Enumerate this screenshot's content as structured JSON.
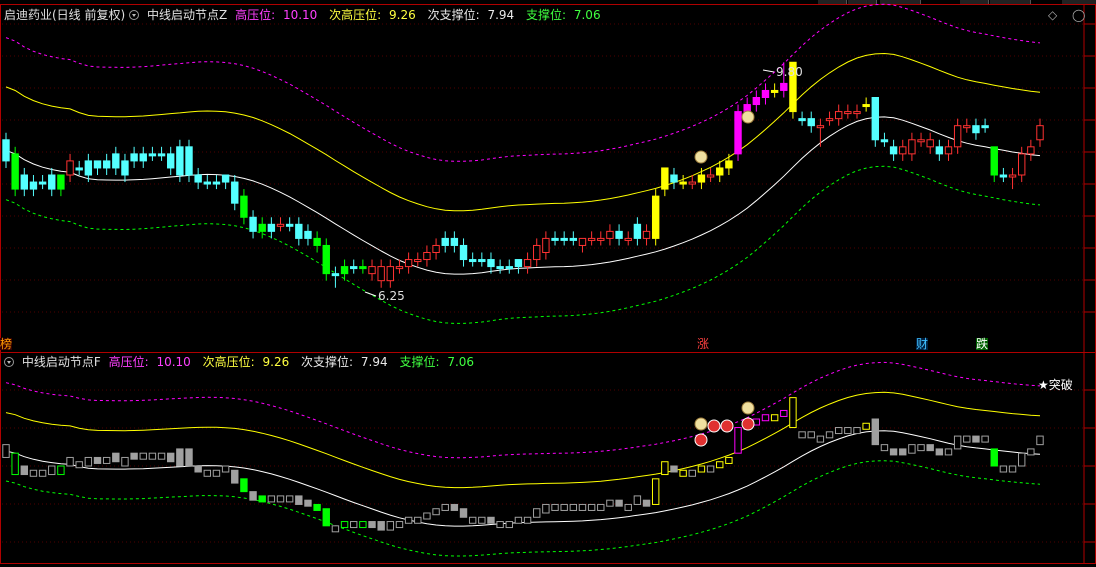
{
  "pane1": {
    "stock": "启迪药业(日线 前复权)",
    "indicator": "中线启动节点Z",
    "high_label": "高压位:",
    "high_val": "10.10",
    "sub_high_label": "次高压位:",
    "sub_high_val": "9.26",
    "sub_sup_label": "次支撑位:",
    "sub_sup_val": "7.94",
    "sup_label": "支撑位:",
    "sup_val": "7.06",
    "high_annot": "9.80",
    "low_annot": "6.25",
    "tags": [
      "榜",
      "涨",
      "财",
      "跌"
    ]
  },
  "pane2": {
    "indicator": "中线启动节点F",
    "high_label": "高压位:",
    "high_val": "10.10",
    "sub_high_label": "次高压位:",
    "sub_high_val": "9.26",
    "sub_sup_label": "次支撑位:",
    "sub_sup_val": "7.94",
    "sup_label": "支撑位:",
    "sup_val": "7.06",
    "breakout": "★突破"
  },
  "colors": {
    "up": "#ff3232",
    "down": "#54ffff",
    "yellow": "#ffff00",
    "magenta": "#ff00ff",
    "green": "#00ff00",
    "white": "#ffffff",
    "grey": "#a0a0a0",
    "frame": "#b00000"
  },
  "chart_data": {
    "type": "candlestick",
    "range": [
      6.25,
      9.8
    ],
    "candles": [
      [
        8.4,
        8.7,
        8.8,
        8.3,
        "c"
      ],
      [
        8.0,
        8.5,
        8.6,
        7.9,
        "g"
      ],
      [
        8.2,
        8.0,
        8.3,
        7.9,
        "c"
      ],
      [
        8.0,
        8.1,
        8.2,
        7.9,
        "c"
      ],
      [
        8.1,
        8.1,
        8.2,
        8.0,
        "c"
      ],
      [
        8.0,
        8.2,
        8.3,
        7.9,
        "c"
      ],
      [
        8.0,
        8.2,
        8.2,
        7.9,
        "g"
      ],
      [
        8.2,
        8.4,
        8.5,
        8.1,
        "r"
      ],
      [
        8.3,
        8.3,
        8.4,
        8.2,
        "c"
      ],
      [
        8.2,
        8.4,
        8.5,
        8.1,
        "c"
      ],
      [
        8.4,
        8.3,
        8.4,
        8.2,
        "c"
      ],
      [
        8.3,
        8.4,
        8.5,
        8.2,
        "c"
      ],
      [
        8.5,
        8.3,
        8.6,
        8.2,
        "c"
      ],
      [
        8.2,
        8.4,
        8.5,
        8.1,
        "c"
      ],
      [
        8.5,
        8.4,
        8.6,
        8.3,
        "c"
      ],
      [
        8.4,
        8.5,
        8.6,
        8.3,
        "c"
      ],
      [
        8.5,
        8.5,
        8.6,
        8.4,
        "c"
      ],
      [
        8.5,
        8.5,
        8.6,
        8.4,
        "c"
      ],
      [
        8.5,
        8.3,
        8.6,
        8.2,
        "c"
      ],
      [
        8.6,
        8.2,
        8.7,
        8.1,
        "c"
      ],
      [
        8.6,
        8.2,
        8.7,
        8.1,
        "c"
      ],
      [
        8.2,
        8.1,
        8.3,
        8.0,
        "c"
      ],
      [
        8.1,
        8.1,
        8.2,
        8.0,
        "c"
      ],
      [
        8.1,
        8.1,
        8.2,
        8.0,
        "c"
      ],
      [
        8.1,
        8.2,
        8.2,
        8.0,
        "c"
      ],
      [
        8.1,
        7.8,
        8.2,
        7.7,
        "c"
      ],
      [
        7.9,
        7.6,
        8.0,
        7.5,
        "g"
      ],
      [
        7.6,
        7.4,
        7.7,
        7.3,
        "c"
      ],
      [
        7.5,
        7.4,
        7.6,
        7.3,
        "g"
      ],
      [
        7.4,
        7.5,
        7.6,
        7.3,
        "c"
      ],
      [
        7.5,
        7.5,
        7.6,
        7.4,
        "r"
      ],
      [
        7.5,
        7.5,
        7.6,
        7.4,
        "c"
      ],
      [
        7.5,
        7.3,
        7.6,
        7.2,
        "c"
      ],
      [
        7.4,
        7.3,
        7.5,
        7.2,
        "c"
      ],
      [
        7.3,
        7.2,
        7.4,
        7.1,
        "g"
      ],
      [
        7.2,
        6.8,
        7.3,
        6.7,
        "g"
      ],
      [
        6.8,
        6.8,
        6.9,
        6.6,
        "c"
      ],
      [
        6.8,
        6.9,
        7.0,
        6.7,
        "g"
      ],
      [
        6.9,
        6.9,
        7.0,
        6.8,
        "c"
      ],
      [
        6.9,
        6.9,
        7.0,
        6.8,
        "g"
      ],
      [
        6.9,
        6.8,
        7.0,
        6.7,
        "r"
      ],
      [
        6.9,
        6.7,
        7.0,
        6.6,
        "r"
      ],
      [
        6.7,
        6.9,
        7.0,
        6.6,
        "r"
      ],
      [
        6.9,
        6.9,
        7.0,
        6.8,
        "r"
      ],
      [
        6.9,
        7.0,
        7.1,
        6.8,
        "r"
      ],
      [
        7.0,
        7.0,
        7.1,
        6.9,
        "r"
      ],
      [
        7.0,
        7.1,
        7.2,
        6.9,
        "r"
      ],
      [
        7.1,
        7.2,
        7.3,
        7.0,
        "r"
      ],
      [
        7.2,
        7.3,
        7.4,
        7.1,
        "c"
      ],
      [
        7.3,
        7.2,
        7.4,
        7.1,
        "c"
      ],
      [
        7.2,
        7.0,
        7.3,
        6.9,
        "c"
      ],
      [
        7.0,
        7.0,
        7.1,
        6.9,
        "c"
      ],
      [
        7.0,
        7.0,
        7.1,
        6.9,
        "c"
      ],
      [
        7.0,
        6.9,
        7.1,
        6.8,
        "c"
      ],
      [
        6.9,
        6.9,
        7.0,
        6.8,
        "c"
      ],
      [
        6.9,
        6.9,
        7.0,
        6.8,
        "c"
      ],
      [
        6.9,
        7.0,
        7.0,
        6.8,
        "c"
      ],
      [
        6.9,
        7.0,
        7.1,
        6.8,
        "r"
      ],
      [
        7.0,
        7.2,
        7.3,
        6.9,
        "r"
      ],
      [
        7.1,
        7.3,
        7.4,
        7.0,
        "r"
      ],
      [
        7.3,
        7.3,
        7.4,
        7.2,
        "c"
      ],
      [
        7.3,
        7.3,
        7.4,
        7.2,
        "c"
      ],
      [
        7.3,
        7.3,
        7.4,
        7.2,
        "c"
      ],
      [
        7.2,
        7.3,
        7.3,
        7.1,
        "r"
      ],
      [
        7.3,
        7.3,
        7.4,
        7.2,
        "r"
      ],
      [
        7.3,
        7.3,
        7.4,
        7.2,
        "r"
      ],
      [
        7.3,
        7.4,
        7.5,
        7.2,
        "r"
      ],
      [
        7.4,
        7.3,
        7.5,
        7.2,
        "c"
      ],
      [
        7.3,
        7.3,
        7.4,
        7.2,
        "r"
      ],
      [
        7.3,
        7.5,
        7.6,
        7.2,
        "c"
      ],
      [
        7.4,
        7.3,
        7.5,
        7.2,
        "r"
      ],
      [
        7.3,
        7.9,
        8.0,
        7.2,
        "y"
      ],
      [
        8.0,
        8.3,
        8.3,
        7.9,
        "y"
      ],
      [
        8.2,
        8.1,
        8.3,
        8.0,
        "c"
      ],
      [
        8.1,
        8.1,
        8.2,
        8.0,
        "y"
      ],
      [
        8.1,
        8.1,
        8.2,
        8.0,
        "r"
      ],
      [
        8.1,
        8.2,
        8.3,
        8.0,
        "y"
      ],
      [
        8.2,
        8.2,
        8.3,
        8.1,
        "r"
      ],
      [
        8.2,
        8.3,
        8.4,
        8.1,
        "y"
      ],
      [
        8.3,
        8.4,
        8.5,
        8.2,
        "y"
      ],
      [
        8.5,
        9.1,
        9.2,
        8.4,
        "m"
      ],
      [
        9.1,
        9.2,
        9.3,
        9.0,
        "m"
      ],
      [
        9.2,
        9.3,
        9.4,
        9.1,
        "m"
      ],
      [
        9.3,
        9.4,
        9.5,
        9.2,
        "m"
      ],
      [
        9.4,
        9.4,
        9.5,
        9.3,
        "y"
      ],
      [
        9.4,
        9.5,
        9.8,
        9.3,
        "m"
      ],
      [
        9.1,
        9.8,
        9.8,
        9.0,
        "y"
      ],
      [
        9.0,
        9.0,
        9.1,
        8.9,
        "c"
      ],
      [
        8.9,
        9.0,
        9.1,
        8.8,
        "c"
      ],
      [
        8.9,
        8.9,
        9.0,
        8.6,
        "r"
      ],
      [
        9.0,
        9.0,
        9.1,
        8.9,
        "r"
      ],
      [
        9.0,
        9.1,
        9.2,
        8.9,
        "r"
      ],
      [
        9.1,
        9.1,
        9.2,
        9.0,
        "r"
      ],
      [
        9.1,
        9.1,
        9.2,
        9.0,
        "r"
      ],
      [
        9.2,
        9.2,
        9.3,
        9.1,
        "y"
      ],
      [
        9.3,
        8.7,
        9.3,
        8.6,
        "c"
      ],
      [
        8.7,
        8.7,
        8.8,
        8.6,
        "c"
      ],
      [
        8.6,
        8.5,
        8.7,
        8.4,
        "c"
      ],
      [
        8.6,
        8.5,
        8.7,
        8.4,
        "r"
      ],
      [
        8.5,
        8.7,
        8.8,
        8.4,
        "r"
      ],
      [
        8.7,
        8.7,
        8.8,
        8.6,
        "r"
      ],
      [
        8.7,
        8.6,
        8.8,
        8.5,
        "r"
      ],
      [
        8.6,
        8.5,
        8.7,
        8.4,
        "c"
      ],
      [
        8.5,
        8.6,
        8.7,
        8.4,
        "r"
      ],
      [
        8.6,
        8.9,
        9.0,
        8.5,
        "r"
      ],
      [
        8.9,
        8.9,
        9.0,
        8.8,
        "r"
      ],
      [
        8.9,
        8.8,
        9.0,
        8.7,
        "c"
      ],
      [
        8.9,
        8.9,
        9.0,
        8.8,
        "c"
      ],
      [
        8.6,
        8.2,
        8.6,
        8.1,
        "g"
      ],
      [
        8.2,
        8.2,
        8.3,
        8.1,
        "c"
      ],
      [
        8.2,
        8.2,
        8.3,
        8.0,
        "r"
      ],
      [
        8.2,
        8.5,
        8.6,
        8.1,
        "r"
      ],
      [
        8.5,
        8.6,
        8.7,
        8.4,
        "r"
      ],
      [
        8.7,
        8.9,
        9.0,
        8.6,
        "r"
      ]
    ]
  }
}
